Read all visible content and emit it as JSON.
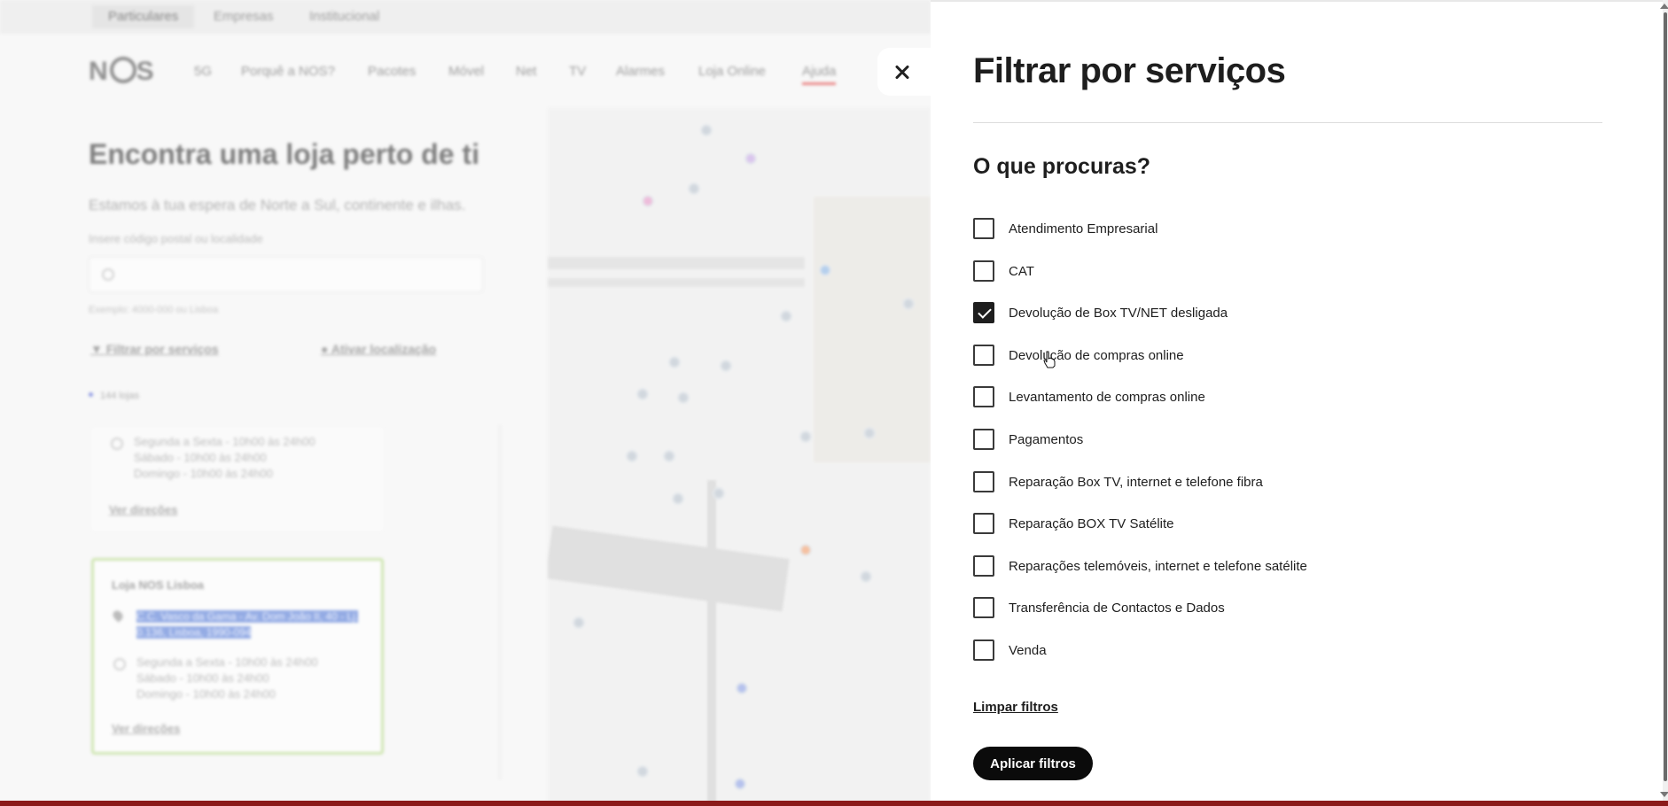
{
  "background": {
    "segments": [
      "Particulares",
      "Empresas",
      "Institucional"
    ],
    "logo": "NOS",
    "nav": [
      "5G",
      "Porquê a NOS?",
      "Pacotes",
      "Móvel",
      "Net",
      "TV",
      "Alarmes",
      "Loja Online",
      "Ajuda"
    ],
    "title": "Encontra uma loja perto de ti",
    "subtitle": "Estamos à tua espera de Norte a Sul, continente e ilhas.",
    "search_hint": "Insere código postal ou localidade",
    "search_example": "Exemplo: 4000-000 ou Lisboa",
    "filter_link": "Filtrar por serviços",
    "location_link": "Ativar localização",
    "store_count": "144 lojas",
    "card1": {
      "hours": [
        "Segunda a Sexta - 10h00 às 24h00",
        "Sábado - 10h00 às 24h00",
        "Domingo - 10h00 às 24h00"
      ],
      "directions": "Ver direções"
    },
    "card2": {
      "name": "Loja NOS Lisboa",
      "address": "C.C. Vasco da Gama - Av. Dom João II, 40 - Lj. 0.136, Lisboa, 1990-094",
      "hours": [
        "Segunda a Sexta - 10h00 às 24h00",
        "Sábado - 10h00 às 24h00",
        "Domingo - 10h00 às 24h00"
      ],
      "directions": "Ver direções"
    }
  },
  "panel": {
    "title": "Filtrar por serviços",
    "subtitle": "O que procuras?",
    "options": [
      {
        "label": "Atendimento Empresarial",
        "checked": false
      },
      {
        "label": "CAT",
        "checked": false
      },
      {
        "label": "Devolução de Box TV/NET desligada",
        "checked": true
      },
      {
        "label": "Devolução de compras online",
        "checked": false
      },
      {
        "label": "Levantamento de compras online",
        "checked": false
      },
      {
        "label": "Pagamentos",
        "checked": false
      },
      {
        "label": "Reparação Box TV, internet e telefone fibra",
        "checked": false
      },
      {
        "label": "Reparação BOX TV Satélite",
        "checked": false
      },
      {
        "label": "Reparações telemóveis, internet e telefone satélite",
        "checked": false
      },
      {
        "label": "Transferência de Contactos e Dados",
        "checked": false
      },
      {
        "label": "Venda",
        "checked": false
      }
    ],
    "clear_label": "Limpar filtros",
    "apply_label": "Aplicar filtros"
  },
  "colors": {
    "accent": "#0b0b0b",
    "nav_underline": "#e04a4a",
    "selected_card_border": "#b6d98a",
    "address_highlight": "#5b7fd6",
    "bottom_bar": "#8b1a1a"
  },
  "icons": {
    "close": "close-icon",
    "checkbox_checked": "checkmark-icon",
    "search": "search-icon",
    "filter": "filter-icon",
    "location": "location-pin-icon",
    "clock": "clock-icon"
  }
}
